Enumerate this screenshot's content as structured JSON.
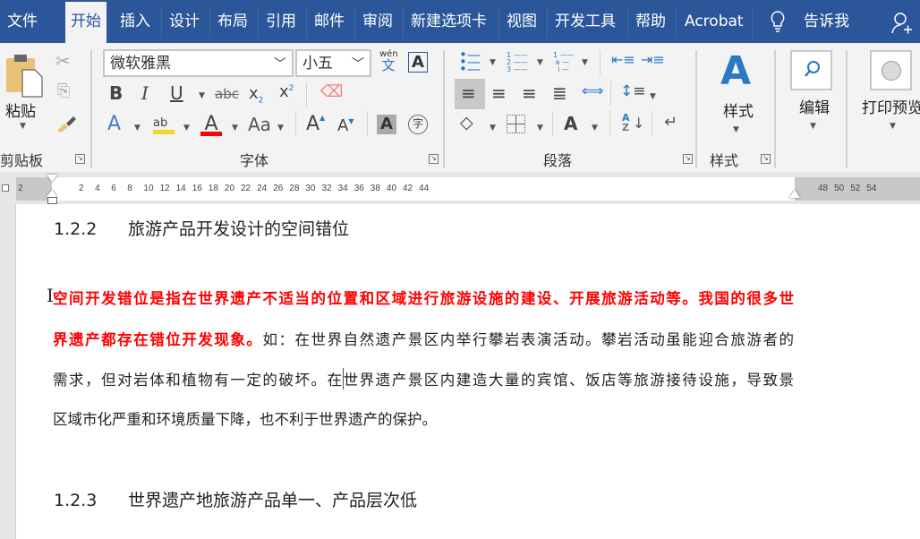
{
  "tabs": [
    {
      "label": "文件"
    },
    {
      "label": "开始",
      "active": true
    },
    {
      "label": "插入"
    },
    {
      "label": "设计"
    },
    {
      "label": "布局"
    },
    {
      "label": "引用"
    },
    {
      "label": "邮件"
    },
    {
      "label": "审阅"
    },
    {
      "label": "新建选项卡"
    },
    {
      "label": "视图"
    },
    {
      "label": "开发工具"
    },
    {
      "label": "帮助"
    },
    {
      "label": "Acrobat"
    }
  ],
  "tell_me": "告诉我",
  "clipboard": {
    "paste": "粘贴",
    "label": "剪贴板"
  },
  "font": {
    "name": "微软雅黑",
    "size": "小五",
    "label": "字体",
    "phonetic_top": "wén",
    "phonetic_char": "文",
    "enclosed_char": "字"
  },
  "paragraph": {
    "label": "段落"
  },
  "styles": {
    "button": "样式",
    "label": "样式"
  },
  "editing": {
    "button": "编辑"
  },
  "print_preview": {
    "button": "打印预览"
  },
  "ruler": {
    "left_ticks": [
      "2"
    ],
    "ticks": [
      "2",
      "4",
      "6",
      "8",
      "10",
      "12",
      "14",
      "16",
      "18",
      "20",
      "22",
      "24",
      "26",
      "28",
      "30",
      "32",
      "34",
      "36",
      "38",
      "40",
      "42",
      "44"
    ],
    "right_ticks": [
      "48",
      "50",
      "52",
      "54"
    ]
  },
  "document": {
    "heading1": {
      "number": "1.2.2",
      "text": "旅游产品开发设计的空间错位"
    },
    "lines": [
      [
        {
          "text": "空间开发错位是指在世界遗产不适当的位置和区域进行旅游设施的建设、开展旅游活动等。我国的很多世",
          "red": true
        }
      ],
      [
        {
          "text": "界遗产都存在错位开发现象。",
          "red": true
        },
        {
          "text": "如：在世界自然遗产景区内举行攀岩表演活动。攀岩活动虽能迎合旅游者的",
          "red": false
        }
      ],
      [
        {
          "text": "需求，但对岩体和植物有一定的破坏。在世界遗产景区内建造大量的宾馆、饭店等旅游接待设施，导致景",
          "red": false
        }
      ],
      [
        {
          "text": "区域市化严重和环境质量下降，也不利于世界遗产的保护。",
          "red": false
        }
      ]
    ],
    "heading2": {
      "number": "1.2.3",
      "text": "世界遗产地旅游产品单一、产品层次低"
    }
  },
  "colors": {
    "brand": "#2b579a",
    "red_text": "#ff0000"
  }
}
